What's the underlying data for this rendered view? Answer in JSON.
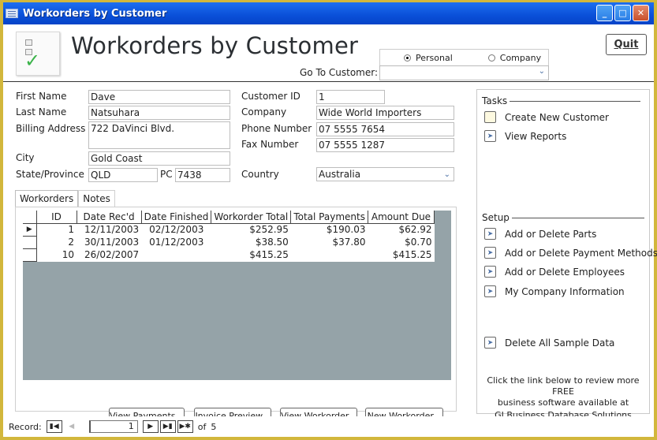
{
  "window": {
    "title": "Workorders by Customer",
    "controls": {
      "minimize": "_",
      "maximize": "□",
      "close": "✕"
    }
  },
  "header": {
    "page_title": "Workorders by Customer",
    "quit_label": "Quit",
    "customer_type": {
      "options": [
        "Personal",
        "Company"
      ],
      "selected": "Personal"
    },
    "goto_label": "Go To Customer:",
    "goto_value": ""
  },
  "customer": {
    "first_name_label": "First Name",
    "first_name": "Dave",
    "last_name_label": "Last Name",
    "last_name": "Natsuhara",
    "billing_address_label": "Billing Address",
    "billing_address": "722 DaVinci Blvd.",
    "city_label": "City",
    "city": "Gold Coast",
    "state_label": "State/Province",
    "state": "QLD",
    "pc_label": "PC",
    "pc": "7438",
    "customer_id_label": "Customer ID",
    "customer_id": "1",
    "company_label": "Company",
    "company": "Wide World Importers",
    "phone_label": "Phone Number",
    "phone": "07 5555 7654",
    "fax_label": "Fax Number",
    "fax": "07 5555 1287",
    "country_label": "Country",
    "country": "Australia"
  },
  "tabs": [
    {
      "label": "Workorders",
      "active": true
    },
    {
      "label": "Notes",
      "active": false
    }
  ],
  "workorders": {
    "columns": [
      "ID",
      "Date Rec'd",
      "Date Finished",
      "Workorder Total",
      "Total Payments",
      "Amount Due"
    ],
    "rows": [
      {
        "id": "1",
        "date_recd": "12/11/2003",
        "date_finished": "02/12/2003",
        "total": "$252.95",
        "payments": "$190.03",
        "due": "$62.92",
        "current": true
      },
      {
        "id": "2",
        "date_recd": "30/11/2003",
        "date_finished": "01/12/2003",
        "total": "$38.50",
        "payments": "$37.80",
        "due": "$0.70",
        "current": false
      },
      {
        "id": "10",
        "date_recd": "26/02/2007",
        "date_finished": "",
        "total": "$415.25",
        "payments": "",
        "due": "$415.25",
        "current": false
      }
    ],
    "buttons": {
      "view_payments": "View Payments...",
      "invoice_preview": "Invoice Preview...",
      "view_workorder": "View Workorder...",
      "new_workorder": "New Workorder..."
    }
  },
  "tasks": {
    "title": "Tasks",
    "items": [
      {
        "label": "Create New Customer",
        "icon": "new-record-icon"
      },
      {
        "label": "View Reports",
        "icon": "arrow-right-icon"
      }
    ]
  },
  "setup": {
    "title": "Setup",
    "items": [
      {
        "label": "Add or Delete Parts",
        "icon": "arrow-right-icon"
      },
      {
        "label": "Add or Delete Payment Methods",
        "icon": "arrow-right-icon"
      },
      {
        "label": "Add or Delete Employees",
        "icon": "arrow-right-icon"
      },
      {
        "label": "My Company Information",
        "icon": "arrow-right-icon"
      }
    ],
    "delete_sample": {
      "label": "Delete All Sample Data",
      "icon": "arrow-right-icon"
    }
  },
  "promo": {
    "line1": "Click the link below to review more FREE",
    "line2": "business software available at",
    "link": "GI Business Database Solutions"
  },
  "record_nav": {
    "label": "Record:",
    "current": "1",
    "of_label": "of",
    "total": "5"
  }
}
